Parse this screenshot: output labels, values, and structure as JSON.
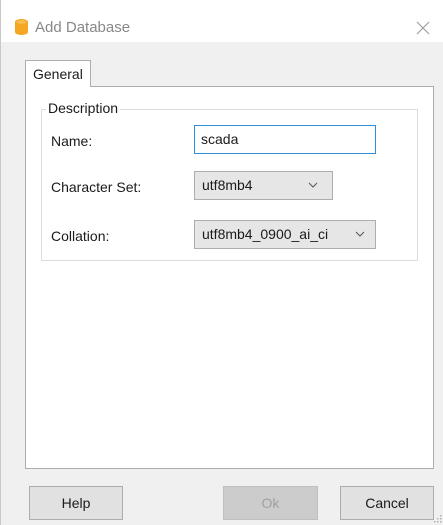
{
  "window": {
    "title": "Add Database",
    "icon": "database-icon",
    "close_icon": "close-icon"
  },
  "tabs": [
    {
      "label": "General",
      "active": true
    }
  ],
  "group": {
    "legend": "Description"
  },
  "fields": {
    "name": {
      "label": "Name:",
      "value": "scada"
    },
    "charset": {
      "label": "Character Set:",
      "value": "utf8mb4"
    },
    "collation": {
      "label": "Collation:",
      "value": "utf8mb4_0900_ai_ci"
    }
  },
  "buttons": {
    "help": "Help",
    "ok": "Ok",
    "cancel": "Cancel"
  },
  "colors": {
    "icon_orange": "#f5a623",
    "focus_border": "#2f8fd8"
  }
}
